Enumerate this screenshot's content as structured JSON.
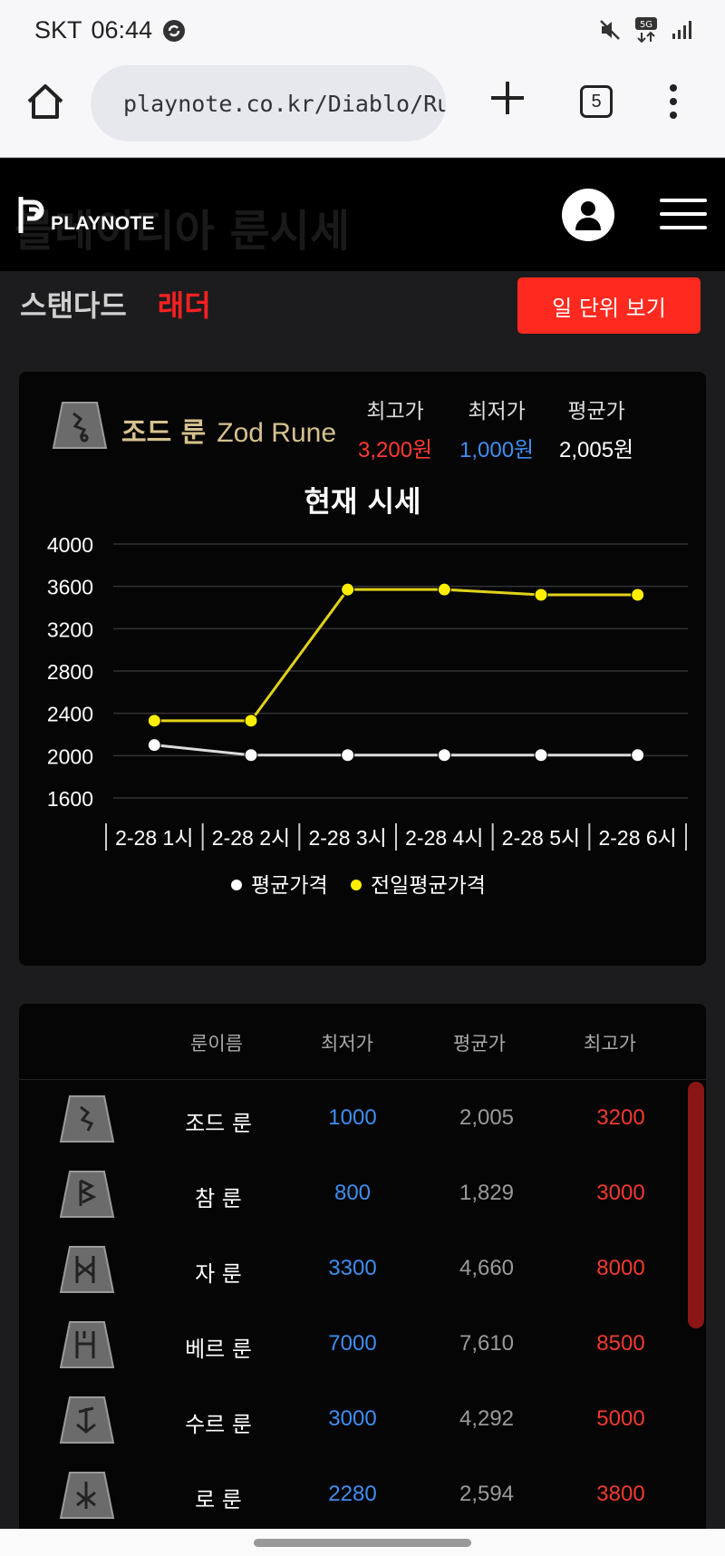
{
  "status": {
    "carrier": "SKT",
    "time": "06:44"
  },
  "browser": {
    "url": "playnote.co.kr/Diablo/Rur",
    "tab_count": "5"
  },
  "site": {
    "logo_text": "PLAYNOTE",
    "ghost_title": "블레이디아 룬시세"
  },
  "modes": {
    "standard": "스탠다드",
    "ladder": "래더",
    "daily_button": "일 단위 보기"
  },
  "rune_card": {
    "name_ko": "조드 룬",
    "name_en": "Zod Rune",
    "max_label": "최고가",
    "max_value": "3,200원",
    "min_label": "최저가",
    "min_value": "1,000원",
    "avg_label": "평균가",
    "avg_value": "2,005원",
    "chart_title": "현재 시세"
  },
  "colors": {
    "max": "#ff3b30",
    "min": "#3f8ef0",
    "avg_series": "#ffffff",
    "prev_series": "#ffee00"
  },
  "chart_data": {
    "type": "line",
    "title": "현재 시세",
    "categories": [
      "2-28 1시",
      "2-28 2시",
      "2-28 3시",
      "2-28 4시",
      "2-28 5시",
      "2-28 6시"
    ],
    "yticks": [
      4000,
      3600,
      3200,
      2800,
      2400,
      2000,
      1600
    ],
    "ylim": [
      1600,
      4000
    ],
    "series": [
      {
        "name": "평균가격",
        "color": "#ffffff",
        "values": [
          2100,
          2005,
          2005,
          2005,
          2005,
          2005
        ]
      },
      {
        "name": "전일평균가격",
        "color": "#ffee00",
        "values": [
          2330,
          2330,
          3570,
          3570,
          3520,
          3520
        ]
      }
    ],
    "legend": "bottom",
    "grid": true
  },
  "table": {
    "headers": {
      "name": "룬이름",
      "min": "최저가",
      "avg": "평균가",
      "max": "최고가"
    },
    "rows": [
      {
        "name": "조드 룬",
        "min": "1000",
        "avg": "2,005",
        "max": "3200"
      },
      {
        "name": "참 룬",
        "min": "800",
        "avg": "1,829",
        "max": "3000"
      },
      {
        "name": "자 룬",
        "min": "3300",
        "avg": "4,660",
        "max": "8000"
      },
      {
        "name": "베르 룬",
        "min": "7000",
        "avg": "7,610",
        "max": "8500"
      },
      {
        "name": "수르 룬",
        "min": "3000",
        "avg": "4,292",
        "max": "5000"
      },
      {
        "name": "로 룬",
        "min": "2280",
        "avg": "2,594",
        "max": "3800"
      }
    ]
  }
}
